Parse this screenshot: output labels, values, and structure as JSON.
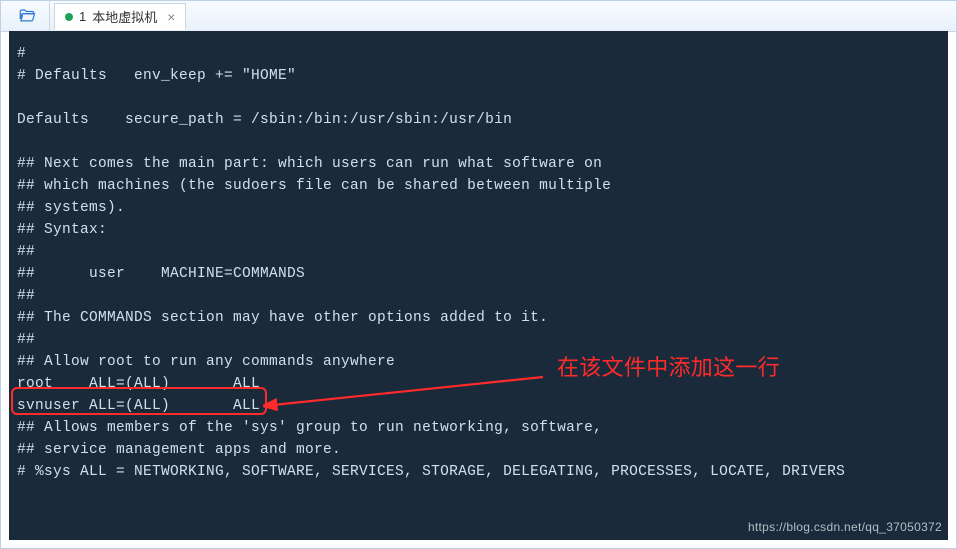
{
  "tab": {
    "index": "1",
    "title": "本地虚拟机"
  },
  "lines": [
    "#",
    "# Defaults   env_keep += \"HOME\"",
    "",
    "Defaults    secure_path = /sbin:/bin:/usr/sbin:/usr/bin",
    "",
    "## Next comes the main part: which users can run what software on",
    "## which machines (the sudoers file can be shared between multiple",
    "## systems).",
    "## Syntax:",
    "##",
    "##      user    MACHINE=COMMANDS",
    "##",
    "## The COMMANDS section may have other options added to it.",
    "##",
    "## Allow root to run any commands anywhere",
    "root    ALL=(ALL)       ALL",
    "svnuser ALL=(ALL)       ALL",
    "## Allows members of the 'sys' group to run networking, software,",
    "## service management apps and more.",
    "# %sys ALL = NETWORKING, SOFTWARE, SERVICES, STORAGE, DELEGATING, PROCESSES, LOCATE, DRIVERS"
  ],
  "annotation": "在该文件中添加这一行",
  "watermark": "https://blog.csdn.net/qq_37050372",
  "colors": {
    "terminal_bg": "#1b2a3a",
    "terminal_fg": "#cfe0ea",
    "highlight": "#ff2a2a",
    "tab_dot": "#1ea356"
  },
  "highlight_line_index": 16
}
